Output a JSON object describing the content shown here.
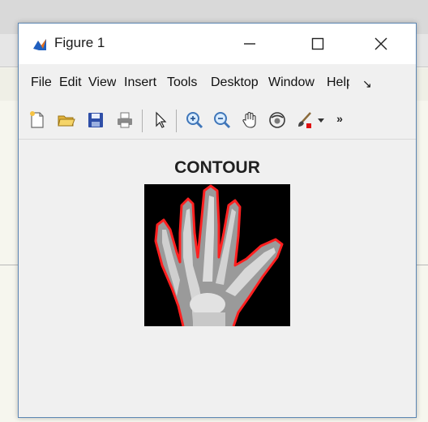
{
  "window": {
    "title": "Figure 1"
  },
  "menu": {
    "items": [
      "File",
      "Edit",
      "View",
      "Insert",
      "Tools",
      "Desktop",
      "Window",
      "Help"
    ],
    "more_indicator": "↘"
  },
  "toolbar": {
    "tools": [
      {
        "name": "new-figure",
        "icon": "new-document-icon"
      },
      {
        "name": "open-file",
        "icon": "open-folder-icon"
      },
      {
        "name": "save-figure",
        "icon": "save-disk-icon"
      },
      {
        "name": "print-figure",
        "icon": "printer-icon"
      },
      {
        "name": "edit-plot",
        "icon": "pointer-arrow-icon"
      },
      {
        "name": "zoom-in",
        "icon": "zoom-in-icon"
      },
      {
        "name": "zoom-out",
        "icon": "zoom-out-icon"
      },
      {
        "name": "pan",
        "icon": "hand-icon"
      },
      {
        "name": "rotate-3d",
        "icon": "rotate-3d-icon"
      },
      {
        "name": "data-brush",
        "icon": "brush-icon"
      }
    ],
    "overflow": "»"
  },
  "figure": {
    "plot_title": "CONTOUR"
  },
  "colors": {
    "contour": "#ff2020",
    "image_background": "#000000",
    "window_border": "#5b86b3"
  }
}
